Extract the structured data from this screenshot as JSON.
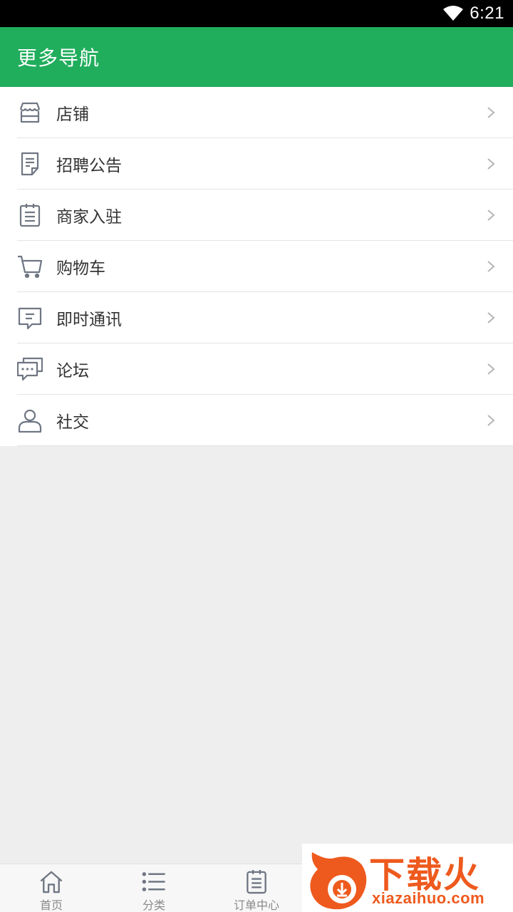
{
  "status_bar": {
    "time": "6:21",
    "wifi_icon": "wifi-icon"
  },
  "app_bar": {
    "title": "更多导航",
    "color": "#20ad5c"
  },
  "menu": {
    "items": [
      {
        "label": "店铺",
        "icon": "store-icon"
      },
      {
        "label": "招聘公告",
        "icon": "document-icon"
      },
      {
        "label": "商家入驻",
        "icon": "clipboard-icon"
      },
      {
        "label": "购物车",
        "icon": "shopping-cart-icon"
      },
      {
        "label": "即时通讯",
        "icon": "message-icon"
      },
      {
        "label": "论坛",
        "icon": "forum-chat-icon"
      },
      {
        "label": "社交",
        "icon": "user-icon"
      }
    ]
  },
  "bottom_nav": {
    "items": [
      {
        "label": "首页",
        "icon": "home-icon"
      },
      {
        "label": "分类",
        "icon": "list-icon"
      },
      {
        "label": "订单中心",
        "icon": "order-icon"
      }
    ]
  },
  "watermark": {
    "brand": "下载火",
    "url": "xiazaihuo.com",
    "color": "#ee5a1e"
  }
}
